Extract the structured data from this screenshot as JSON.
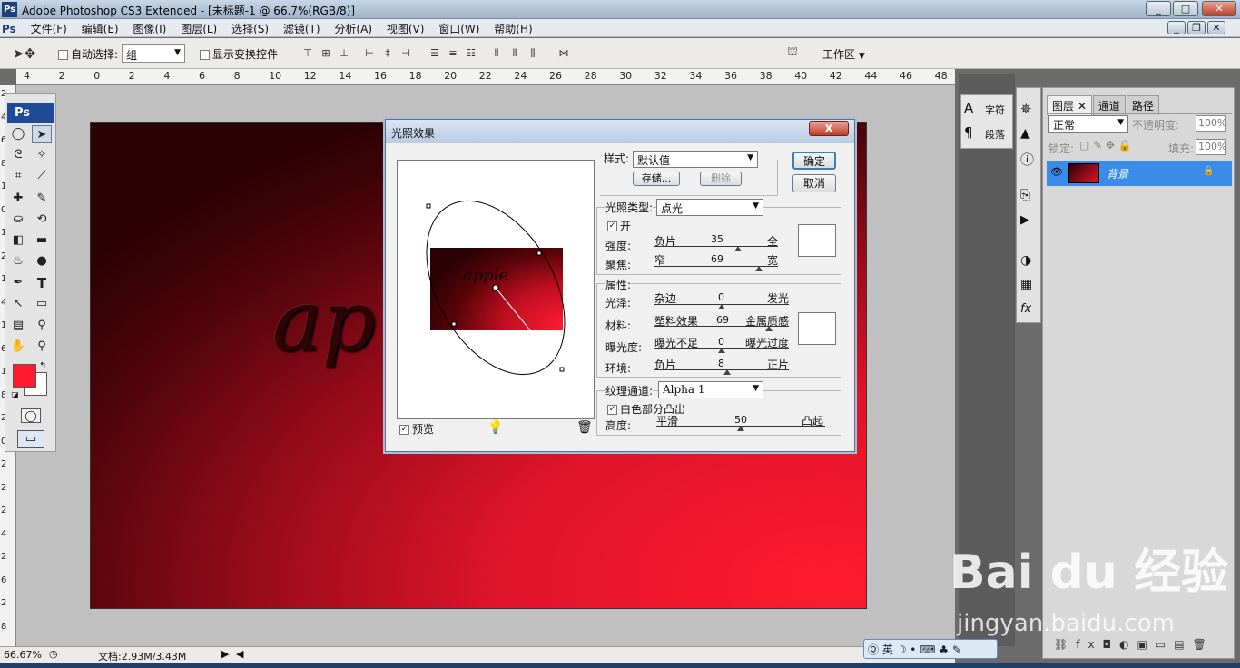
{
  "app": {
    "title": "Adobe Photoshop CS3 Extended - [未标题-1 @ 66.7%(RGB/8)]",
    "ps_logo": "Ps",
    "win_min": "_",
    "win_max": "□",
    "win_close": "✕"
  },
  "menu": [
    "文件(F)",
    "编辑(E)",
    "图像(I)",
    "图层(L)",
    "选择(S)",
    "滤镜(T)",
    "分析(A)",
    "视图(V)",
    "窗口(W)",
    "帮助(H)"
  ],
  "options": {
    "auto_select_label": "自动选择:",
    "auto_select_value": "组",
    "show_transform_label": "显示变换控件",
    "workspace_label": "工作区"
  },
  "ruler_top": [
    "4",
    "2",
    "0",
    "2",
    "4",
    "6",
    "8",
    "10",
    "12",
    "14",
    "16",
    "18",
    "20",
    "22",
    "24",
    "26",
    "28",
    "30",
    "32",
    "34",
    "36",
    "38",
    "40",
    "42",
    "44",
    "46",
    "48"
  ],
  "ruler_left": [
    "2",
    "4",
    "6",
    "8",
    "1",
    "0",
    "1",
    "2",
    "1",
    "4",
    "1",
    "6",
    "1",
    "8",
    "2",
    "0",
    "2",
    "2",
    "2",
    "4",
    "2",
    "6",
    "2",
    "8"
  ],
  "canvas": {
    "text": "ap"
  },
  "toolbox": {
    "logo": "Ps"
  },
  "status": {
    "zoom": "66.67%",
    "doc": "文档:2.93M/3.43M"
  },
  "char_panel": {
    "char": "字符",
    "para": "段落"
  },
  "layers_panel": {
    "tabs": [
      "图层",
      "通道",
      "路径"
    ],
    "blend_mode": "正常",
    "opacity_label": "不透明度:",
    "opacity": "100%",
    "lock_label": "锁定:",
    "fill_label": "填充:",
    "fill": "100%",
    "layer_name": "背景"
  },
  "dialog": {
    "title": "光照效果",
    "close": "x",
    "style_label": "样式:",
    "style_value": "默认值",
    "save_btn": "存储...",
    "delete_btn": "删除",
    "ok": "确定",
    "cancel": "取消",
    "light_type_label": "光照类型:",
    "light_type_value": "点光",
    "on_label": "开",
    "intensity": {
      "label": "强度:",
      "left": "负片",
      "value": "35",
      "right": "全"
    },
    "focus": {
      "label": "聚焦:",
      "left": "窄",
      "value": "69",
      "right": "宽"
    },
    "properties_label": "属性:",
    "gloss": {
      "label": "光泽:",
      "left": "杂边",
      "value": "0",
      "right": "发光"
    },
    "material": {
      "label": "材料:",
      "left": "塑料效果",
      "value": "69",
      "right": "金属质感"
    },
    "exposure": {
      "label": "曝光度:",
      "left": "曝光不足",
      "value": "0",
      "right": "曝光过度"
    },
    "ambience": {
      "label": "环境:",
      "left": "负片",
      "value": "8",
      "right": "正片"
    },
    "texture_label": "纹理通道:",
    "texture_value": "Alpha 1",
    "white_high_label": "白色部分凸出",
    "height": {
      "label": "高度:",
      "left": "平滑",
      "value": "50",
      "right": "凸起"
    },
    "preview_label": "预览",
    "preview_text": "apple"
  },
  "watermark": {
    "brand": "Bai du 经验",
    "url": "jingyan.baidu.com"
  },
  "ime": {
    "lang": "英"
  }
}
